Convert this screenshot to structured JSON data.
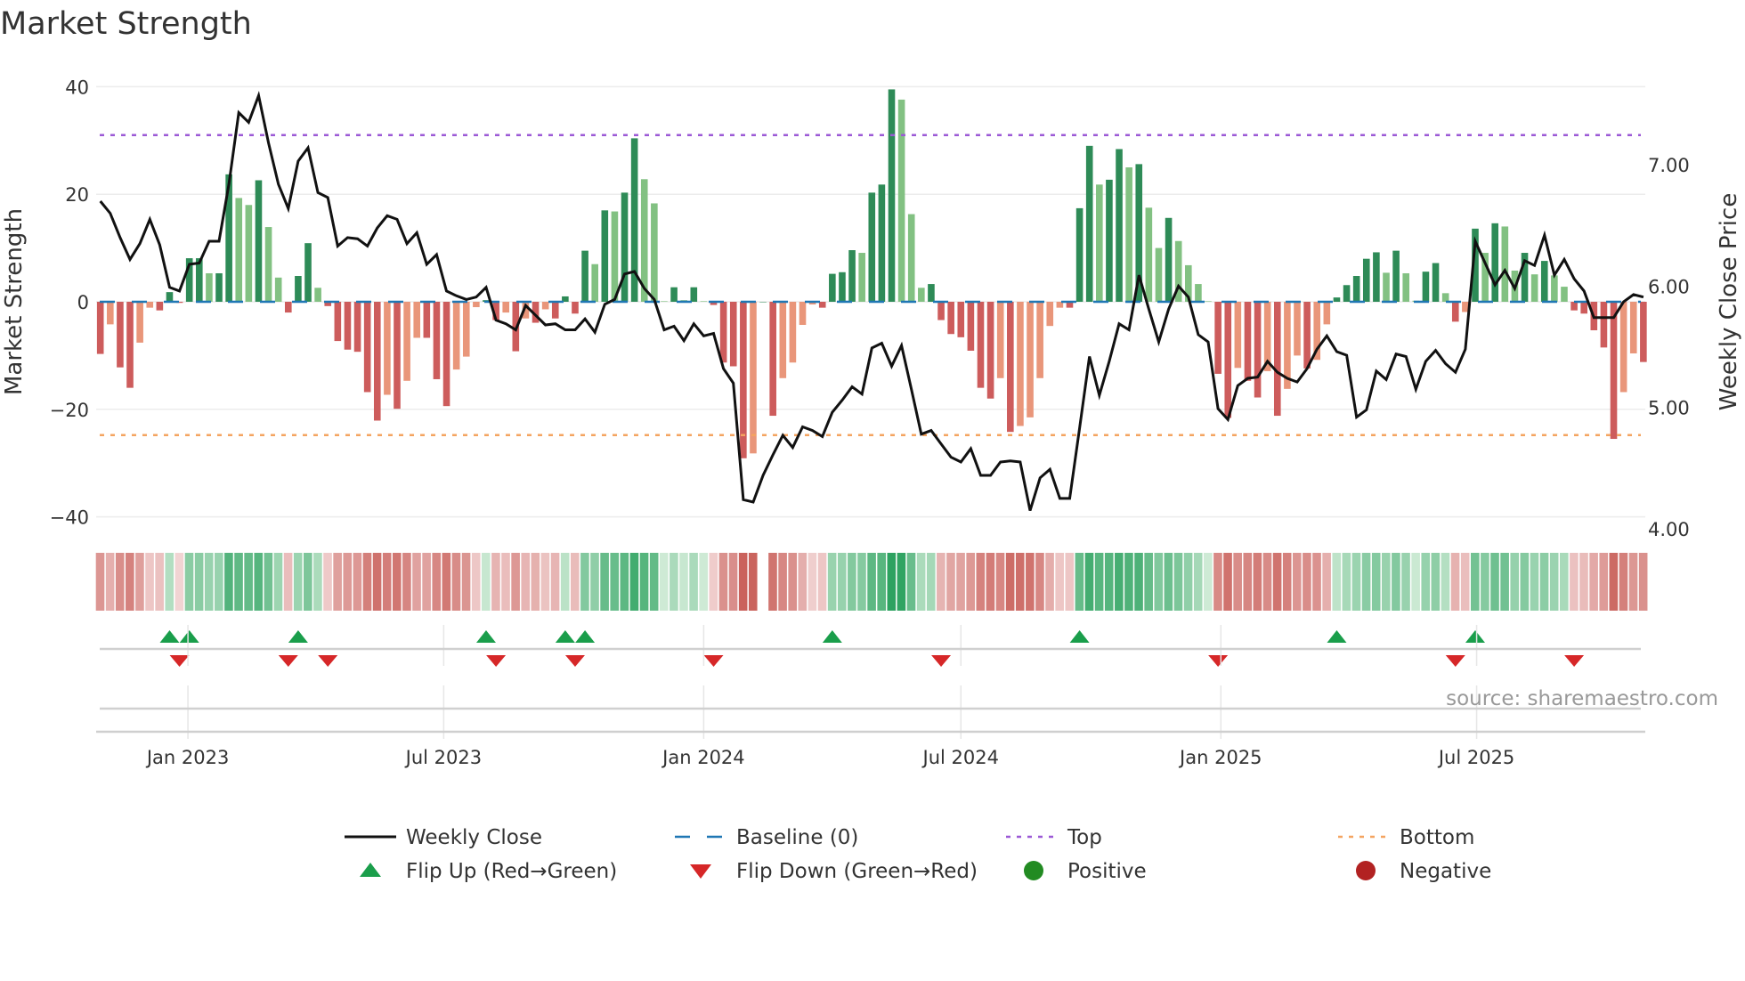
{
  "chart_data": {
    "type": "bar",
    "title": "Market Strength",
    "ylabel": "Market Strength",
    "y2label": "Weekly Close Price",
    "ylim": [
      -42,
      42
    ],
    "y2lim": [
      4.0,
      7.73
    ],
    "yticks": [
      "40",
      "20",
      "0",
      "−20",
      "−40"
    ],
    "ytick_values": [
      40,
      20,
      0,
      -20,
      -40
    ],
    "y2ticks": [
      "7.00",
      "6.00",
      "5.00",
      "4.00"
    ],
    "y2tick_values": [
      7,
      6,
      5,
      4
    ],
    "xticks": [
      "Jan 2023",
      "Jul 2023",
      "Jan 2024",
      "Jul 2024",
      "Jan 2025",
      "Jul 2025"
    ],
    "xtick_dates": [
      "2023-01-01",
      "2023-07-01",
      "2024-01-01",
      "2024-07-01",
      "2025-01-01",
      "2025-07-01"
    ],
    "x_start": "2022-10-31",
    "x_step_days": 7,
    "grid": true,
    "top_level": 31,
    "bottom_level": -24.8,
    "baseline": 0,
    "strength": [
      -9.7,
      -4.2,
      -12.2,
      -16,
      -7.6,
      -1.1,
      -1.6,
      1.8,
      -0.2,
      8.1,
      8.1,
      5.3,
      5.3,
      23.7,
      19.3,
      18,
      22.6,
      13.9,
      4.5,
      -2,
      4.8,
      10.9,
      2.6,
      -0.8,
      -7.3,
      -8.9,
      -9.3,
      -16.8,
      -22.1,
      -17.3,
      -19.9,
      -14.7,
      -6.7,
      -6.7,
      -14.4,
      -19.4,
      -12.6,
      -10.2,
      -1,
      0.3,
      -3.4,
      -2,
      -9.2,
      -3.1,
      -3.9,
      -1.4,
      -3.1,
      1,
      -2.2,
      9.5,
      7,
      17,
      16.8,
      20.3,
      30.4,
      22.8,
      18.3,
      0.1,
      2.7,
      0.3,
      2.7,
      0.1,
      -0.6,
      -11.3,
      -12,
      -29.1,
      -28.2,
      0,
      -21.2,
      -14.2,
      -11.3,
      -4.3,
      -0.5,
      -1.1,
      5.2,
      5.5,
      9.6,
      9.1,
      20.3,
      21.8,
      39.5,
      37.6,
      16.3,
      2.6,
      3.3,
      -3.4,
      -6,
      -6.6,
      -9.1,
      -16,
      -18,
      -14.2,
      -24.2,
      -23.1,
      -21.5,
      -14.2,
      -4.5,
      -1.1,
      -1.1,
      17.4,
      29,
      21.8,
      22.7,
      28.4,
      25,
      25.6,
      17.5,
      10,
      15.6,
      11.3,
      6.8,
      3.3,
      0.1,
      -13.4,
      -21.6,
      -12.3,
      -14.7,
      -17.8,
      -12.9,
      -21.2,
      -16.2,
      -10,
      -12.4,
      -10.8,
      -4.2,
      0.8,
      3.1,
      4.8,
      8,
      9.2,
      5.4,
      9.5,
      5.3,
      0.2,
      5.6,
      7.2,
      1.6,
      -3.7,
      -1.9,
      13.6,
      9.1,
      14.6,
      14,
      5.8,
      9.1,
      5.1,
      7.6,
      4.9,
      2.8,
      -1.6,
      -2.2,
      -5.3,
      -8.5,
      -25.5,
      -16.8,
      -9.6,
      -11.2
    ],
    "weekly_close": [
      6.7,
      6.6,
      6.4,
      6.22,
      6.35,
      6.55,
      6.34,
      5.99,
      5.96,
      6.18,
      6.19,
      6.37,
      6.37,
      6.84,
      7.43,
      7.35,
      7.57,
      7.18,
      6.84,
      6.64,
      7.03,
      7.14,
      6.77,
      6.73,
      6.33,
      6.4,
      6.39,
      6.33,
      6.48,
      6.58,
      6.55,
      6.35,
      6.44,
      6.18,
      6.26,
      5.96,
      5.92,
      5.89,
      5.91,
      5.99,
      5.72,
      5.69,
      5.64,
      5.84,
      5.76,
      5.68,
      5.69,
      5.64,
      5.64,
      5.73,
      5.62,
      5.85,
      5.89,
      6.1,
      6.12,
      5.98,
      5.89,
      5.64,
      5.67,
      5.55,
      5.69,
      5.59,
      5.61,
      5.32,
      5.2,
      4.24,
      4.22,
      4.44,
      4.61,
      4.77,
      4.67,
      4.84,
      4.81,
      4.76,
      4.96,
      5.06,
      5.17,
      5.11,
      5.49,
      5.53,
      5.34,
      5.51,
      5.15,
      4.78,
      4.81,
      4.7,
      4.59,
      4.55,
      4.66,
      4.44,
      4.44,
      4.55,
      4.56,
      4.55,
      4.15,
      4.42,
      4.49,
      4.25,
      4.25,
      4.83,
      5.42,
      5.1,
      5.38,
      5.69,
      5.64,
      6.09,
      5.81,
      5.54,
      5.81,
      6.0,
      5.91,
      5.6,
      5.54,
      4.99,
      4.9,
      5.18,
      5.24,
      5.25,
      5.38,
      5.29,
      5.24,
      5.21,
      5.32,
      5.48,
      5.59,
      5.46,
      5.43,
      4.92,
      4.98,
      5.3,
      5.23,
      5.44,
      5.42,
      5.15,
      5.38,
      5.47,
      5.36,
      5.29,
      5.48,
      6.37,
      6.19,
      6.01,
      6.13,
      5.98,
      6.21,
      6.17,
      6.42,
      6.09,
      6.22,
      6.06,
      5.96,
      5.74,
      5.74,
      5.74,
      5.87,
      5.93,
      5.91
    ],
    "flip_up_weeks": [
      7,
      9,
      20,
      39,
      47,
      49,
      74,
      99,
      125,
      139
    ],
    "flip_down_weeks": [
      8,
      19,
      23,
      40,
      48,
      62,
      85,
      113,
      137,
      149
    ],
    "legend": [
      {
        "label": "Weekly Close",
        "kind": "line"
      },
      {
        "label": "Baseline (0)",
        "kind": "dash"
      },
      {
        "label": "Top",
        "kind": "dot-top"
      },
      {
        "label": "Bottom",
        "kind": "dot-bottom"
      },
      {
        "label": "Flip Up (Red→Green)",
        "kind": "tri-up"
      },
      {
        "label": "Flip Down (Green→Red)",
        "kind": "tri-down"
      },
      {
        "label": "Positive",
        "kind": "circle-pos"
      },
      {
        "label": "Negative",
        "kind": "circle-neg"
      }
    ],
    "legend_placement": "bottom",
    "source": "source: sharemaestro.com"
  },
  "colors": {
    "pos_strong": "#2e8b57",
    "pos_weak": "#82c182",
    "neg_strong": "#cd5c5c",
    "neg_weak": "#e9967a",
    "price": "#111111",
    "baseline": "#1f77b4",
    "top": "#9b59d6",
    "bottom": "#f4a460",
    "flip_up": "#1a9e4b",
    "flip_down": "#d62728",
    "positive": "#228b22",
    "negative": "#b22222"
  }
}
